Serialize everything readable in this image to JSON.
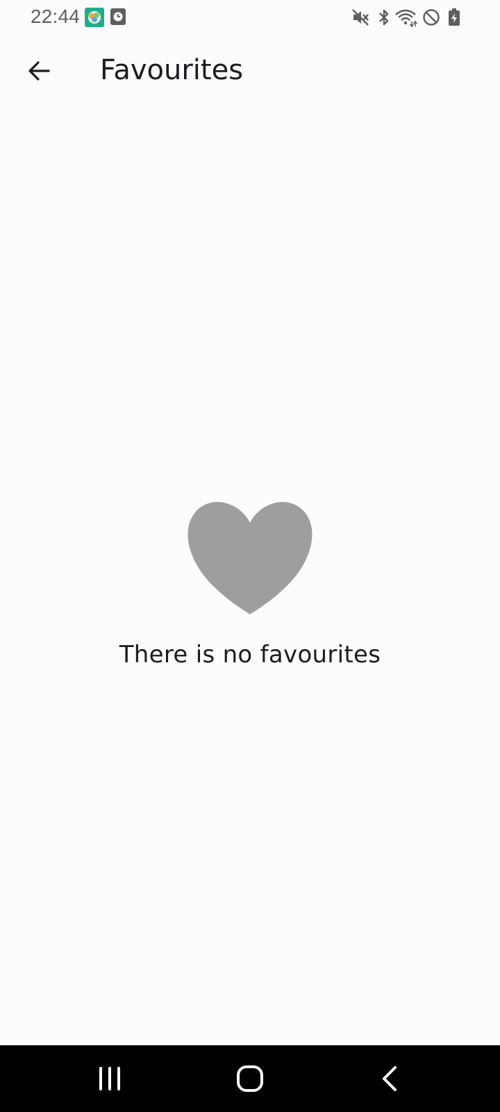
{
  "status_bar": {
    "time": "22:44",
    "left_icons": [
      "app-notification-icon",
      "clock-app-icon"
    ],
    "right_icons": [
      "mute-icon",
      "bluetooth-icon",
      "wifi-icon",
      "do-not-disturb-icon",
      "battery-charging-icon"
    ]
  },
  "app_bar": {
    "back_icon": "arrow-left-icon",
    "title": "Favourites"
  },
  "empty_state": {
    "icon": "heart-icon",
    "message": "There is no favourites",
    "icon_color": "#9e9e9e"
  },
  "nav_bar": {
    "buttons": [
      "recent-apps",
      "home",
      "back"
    ]
  },
  "colors": {
    "background": "#fefbfe",
    "text": "#1d1b20",
    "nav_background": "#000000"
  }
}
